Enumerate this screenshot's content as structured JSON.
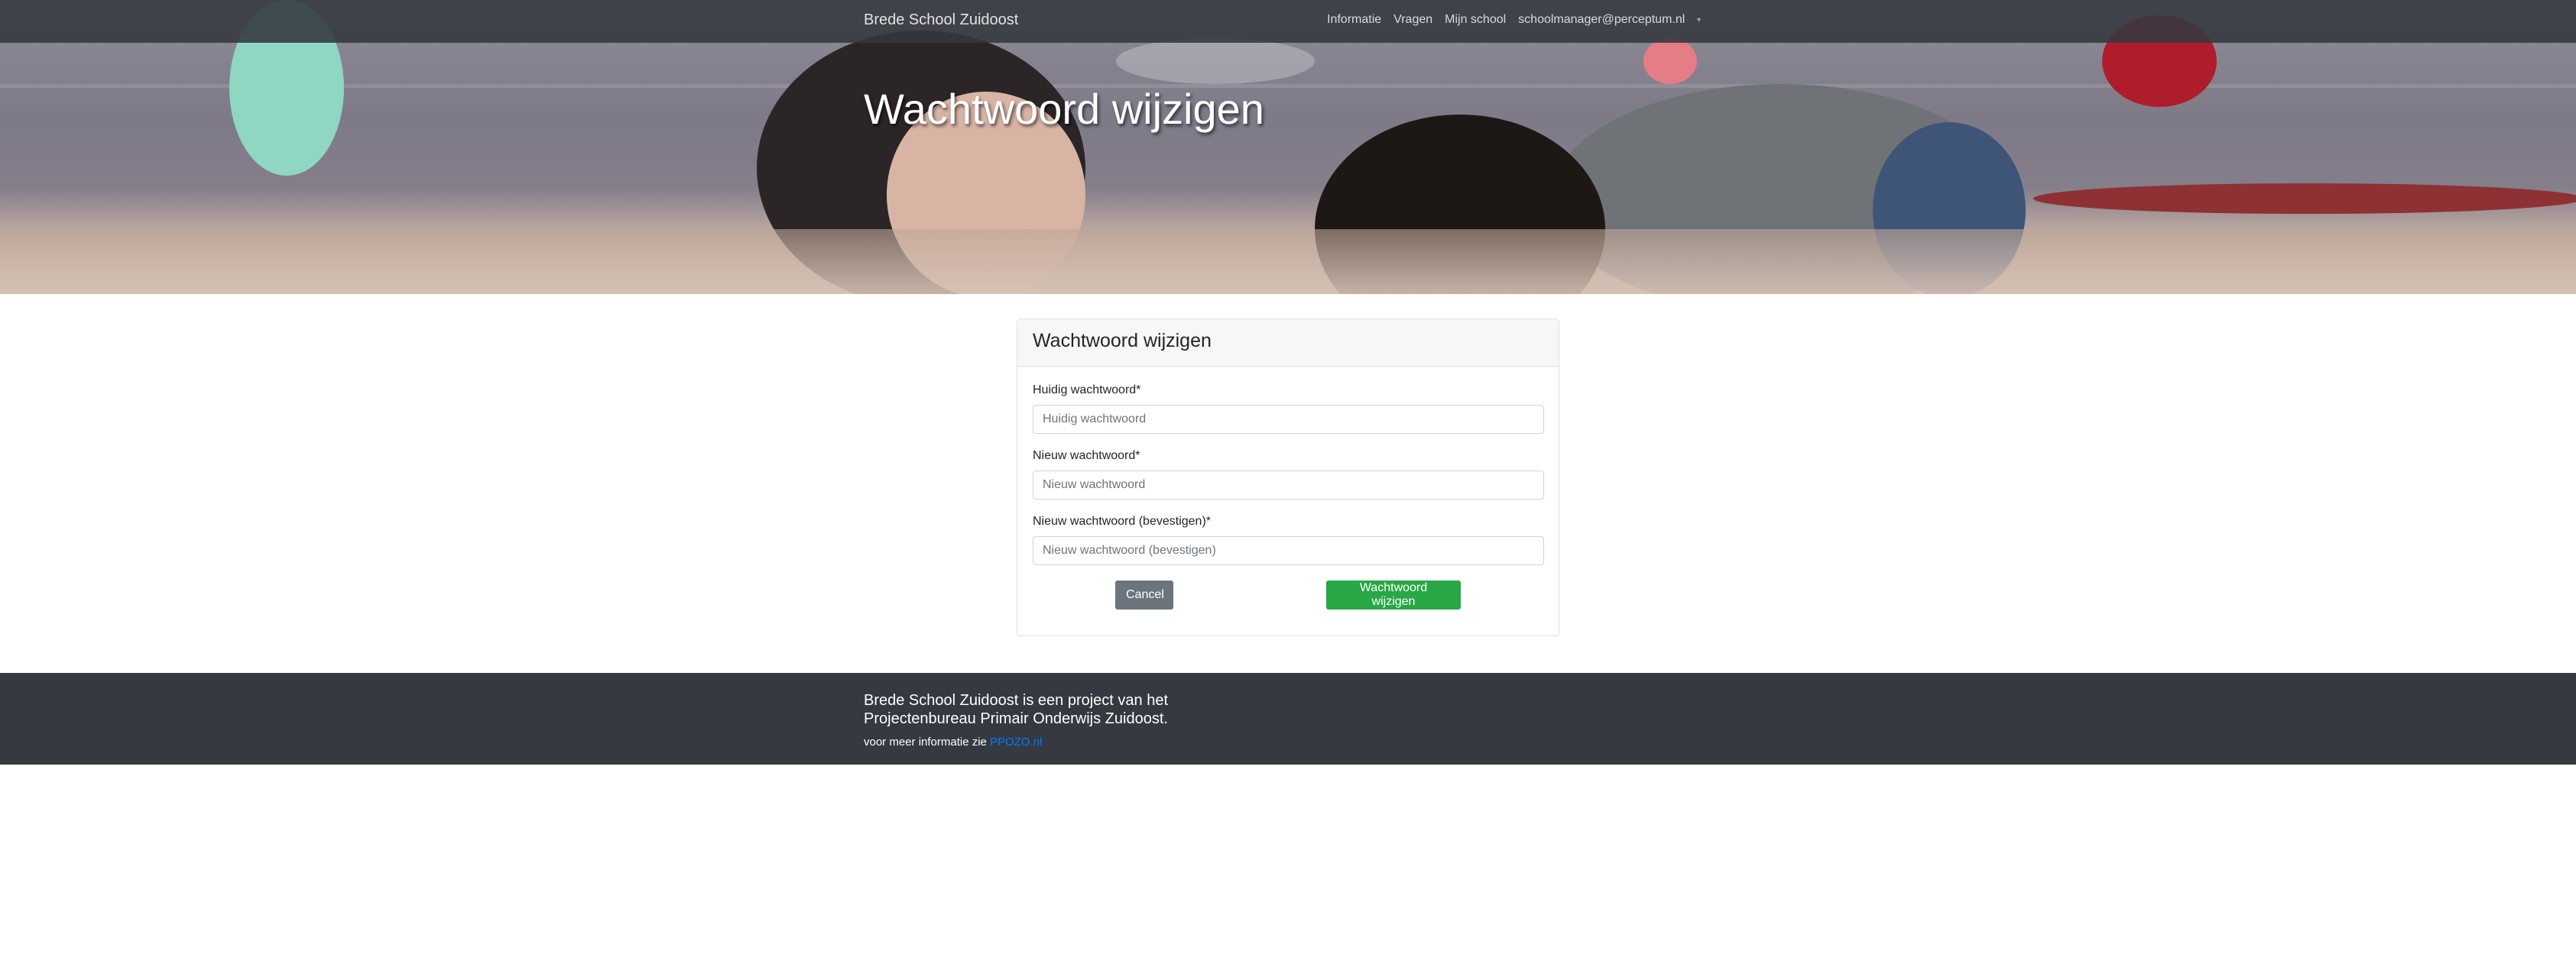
{
  "navbar": {
    "brand": "Brede School Zuidoost",
    "links": [
      "Informatie",
      "Vragen",
      "Mijn school",
      "schoolmanager@perceptum.nl"
    ],
    "dropdown_icon": "caret-down-icon"
  },
  "hero": {
    "title": "Wachtwoord wijzigen"
  },
  "card": {
    "header": "Wachtwoord wijzigen",
    "fields": [
      {
        "label": "Huidig wachtwoord*",
        "placeholder": "Huidig wachtwoord",
        "value": ""
      },
      {
        "label": "Nieuw wachtwoord*",
        "placeholder": "Nieuw wachtwoord",
        "value": ""
      },
      {
        "label": "Nieuw wachtwoord (bevestigen)*",
        "placeholder": "Nieuw wachtwoord (bevestigen)",
        "value": ""
      }
    ],
    "cancel_label": "Cancel",
    "submit_label": "Wachtwoord wijzigen"
  },
  "footer": {
    "text": "Brede School Zuidoost is een project van het Projectenbureau Primair Onderwijs Zuidoost.",
    "info_prefix": "voor meer informatie zie ",
    "link_text": "PPOZO.nl"
  },
  "colors": {
    "navbar": "#34383e",
    "footer": "#343a40",
    "submit_button": "#28a745",
    "cancel_button": "#6c757d",
    "link": "#007bff"
  }
}
